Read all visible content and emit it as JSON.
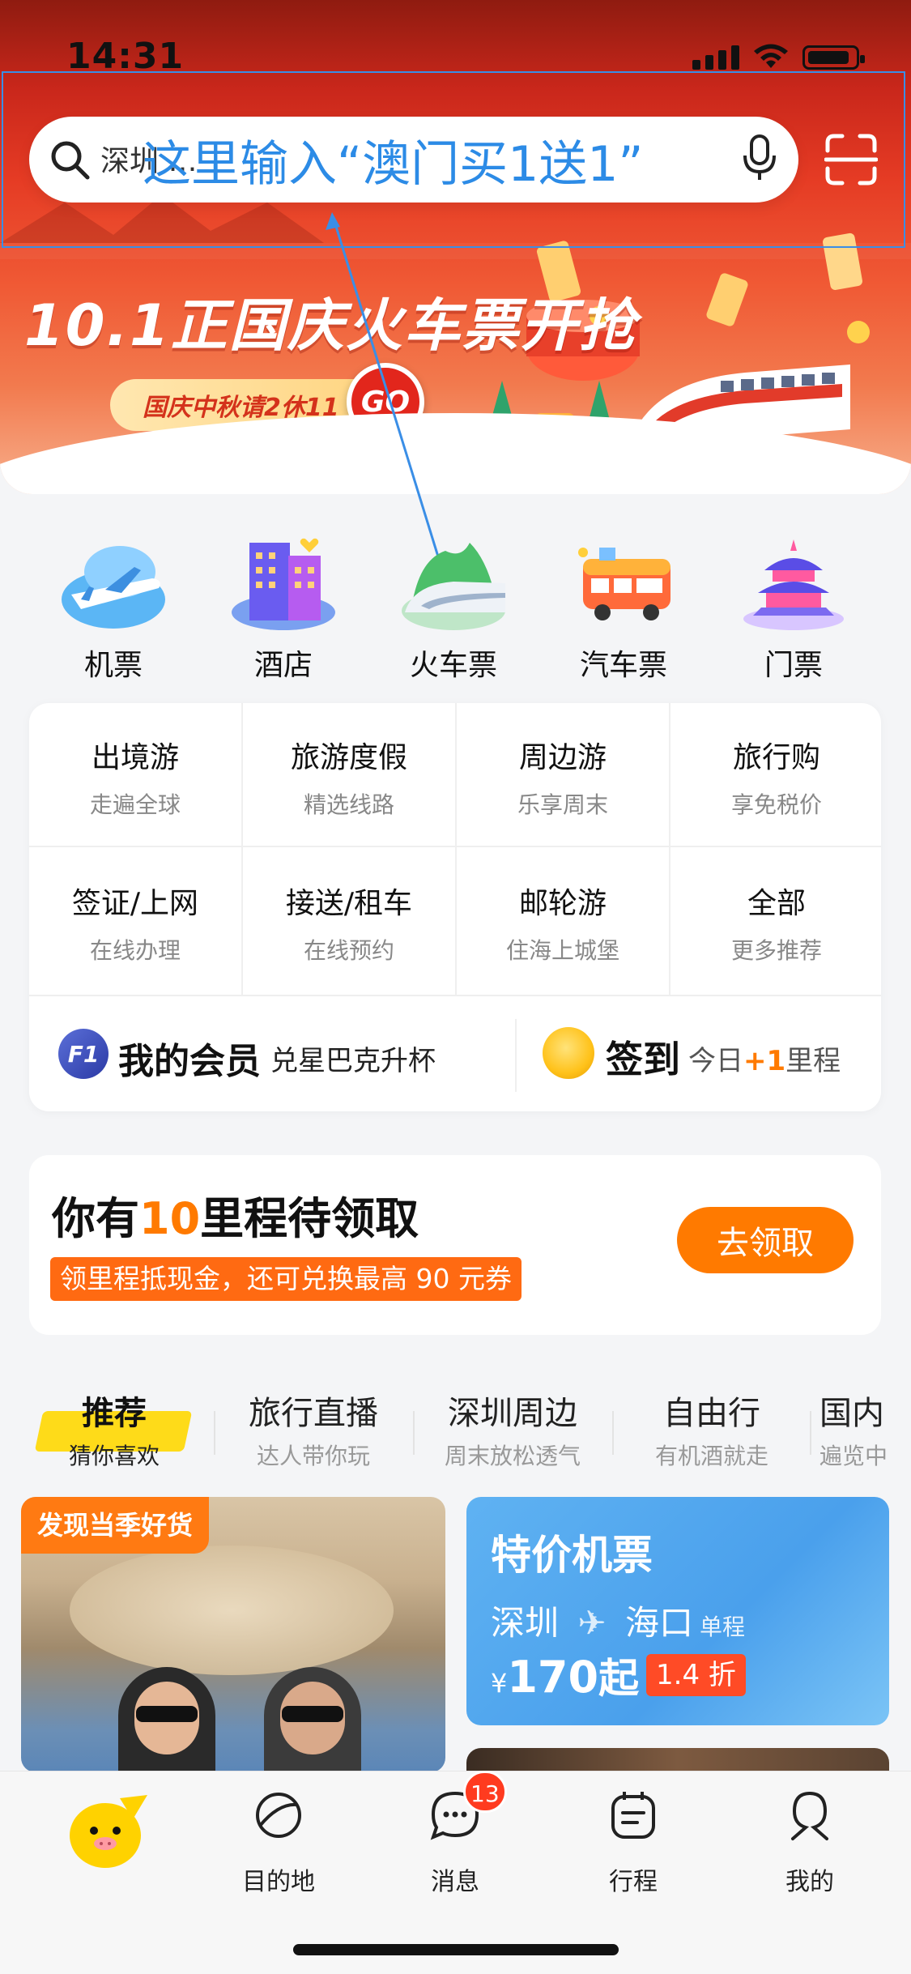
{
  "status_bar": {
    "time": "14:31"
  },
  "search": {
    "placeholder_text": "深圳 …",
    "annotation": "这里输入“澳门买1送1”"
  },
  "banner": {
    "title": "10.1正国庆火车票开抢",
    "pill": "国庆中秋请2休11",
    "go": "GO",
    "dots_total": 5,
    "dots_active_index": 1
  },
  "quick_icons": [
    {
      "label": "机票",
      "icon": "plane-icon"
    },
    {
      "label": "酒店",
      "icon": "hotel-icon"
    },
    {
      "label": "火车票",
      "icon": "train-icon"
    },
    {
      "label": "汽车票",
      "icon": "bus-icon"
    },
    {
      "label": "门票",
      "icon": "temple-icon"
    }
  ],
  "grid": [
    {
      "title": "出境游",
      "sub": "走遍全球"
    },
    {
      "title": "旅游度假",
      "sub": "精选线路"
    },
    {
      "title": "周边游",
      "sub": "乐享周末"
    },
    {
      "title": "旅行购",
      "sub": "享免税价"
    },
    {
      "title": "签证/上网",
      "sub": "在线办理"
    },
    {
      "title": "接送/租车",
      "sub": "在线预约"
    },
    {
      "title": "邮轮游",
      "sub": "住海上城堡"
    },
    {
      "title": "全部",
      "sub": "更多推荐"
    }
  ],
  "member": {
    "badge": "F1",
    "title": "我的会员",
    "sub": "兑星巴克升杯",
    "signin_title": "签到",
    "signin_prefix": "今日",
    "signin_value": "+1",
    "signin_suffix": "里程"
  },
  "miles": {
    "title_prefix": "你有",
    "title_num": "10",
    "title_suffix": "里程待领取",
    "tag": "领里程抵现金，还可兑换最高 90 元券",
    "button": "去领取"
  },
  "tabs": [
    {
      "title": "推荐",
      "sub": "猜你喜欢"
    },
    {
      "title": "旅行直播",
      "sub": "达人带你玩"
    },
    {
      "title": "深圳周边",
      "sub": "周末放松透气"
    },
    {
      "title": "自由行",
      "sub": "有机酒就走"
    },
    {
      "title": "国内",
      "sub": "遍览中"
    }
  ],
  "feed": {
    "left_badge": "发现当季好货",
    "right_title": "特价机票",
    "right_from": "深圳",
    "right_to": "海口",
    "right_trip": "单程",
    "right_currency": "¥",
    "right_price": "170",
    "right_price_suffix": "起",
    "right_discount": "1.4 折"
  },
  "bottom_nav": [
    {
      "label": "",
      "icon": "fliggy-logo-icon"
    },
    {
      "label": "目的地",
      "icon": "planet-icon"
    },
    {
      "label": "消息",
      "icon": "chat-icon",
      "badge": "13"
    },
    {
      "label": "行程",
      "icon": "itinerary-icon"
    },
    {
      "label": "我的",
      "icon": "profile-icon"
    }
  ],
  "colors": {
    "accent_orange": "#ff7a00",
    "annotation_blue": "#2c8be6",
    "banner_red": "#e53b24"
  }
}
